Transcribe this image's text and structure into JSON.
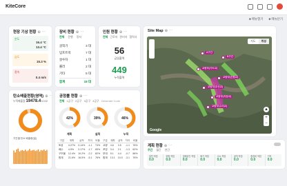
{
  "app": {
    "brand": "KiteCore"
  },
  "subbar": {
    "item1": "■ 메뉴열기",
    "item2": "■ 메뉴닫기"
  },
  "weather": {
    "title": "현장 기상 현황",
    "t1_label": "온도",
    "t1_max": "16.4 °C",
    "t1_min": "13.4 °C",
    "h_label": "습도",
    "h_val": "15.3 %",
    "w_label": "풍속",
    "w_val": "0.4 m/s"
  },
  "equipment": {
    "title": "장비 현황",
    "tabs": [
      "전체",
      "운행",
      "정지"
    ],
    "rows": [
      {
        "name": "굴착기",
        "value": "3 대"
      },
      {
        "name": "덤프트럭",
        "value": "7 대"
      },
      {
        "name": "살수차",
        "value": "1 대"
      },
      {
        "name": "롤러",
        "value": "2 대"
      },
      {
        "name": "기타",
        "value": "5 대"
      }
    ],
    "total_label": "합계",
    "total_value": "18 대"
  },
  "personnel": {
    "title": "인원 현황",
    "tabs": [
      "전체",
      "근로자",
      "관리자",
      "협력사"
    ],
    "v1": "56",
    "v1_label": "금일출역",
    "v2": "449",
    "v2_label": "누적출역"
  },
  "emission": {
    "title": "탄소배출현황(영역)",
    "big_label": "누적배출량",
    "big_value": "19478.4",
    "big_unit": "tCO2",
    "donut_pct": 0.95,
    "bar_title": "기간별 탄소 배출량(일)",
    "bars": [
      0.7,
      0.6,
      0.75,
      0.8,
      0.65,
      0.7,
      0.72,
      0.68,
      0.74,
      0.66,
      0.7,
      0.78,
      0.69,
      0.71,
      0.73,
      0.67,
      0.7,
      0.76,
      0.64,
      0.72,
      0.7,
      0.75,
      0.68,
      0.73
    ]
  },
  "progress": {
    "title": "공정률 현황",
    "tabs": [
      "전체",
      "1공구",
      "2공구",
      "3공구",
      "4공구"
    ],
    "extra": "Generate Code",
    "donuts": [
      {
        "pct": "42%",
        "frac": 0.42,
        "label": "계획"
      },
      {
        "pct": "39%",
        "frac": 0.39,
        "label": "실적"
      },
      {
        "pct": "46%",
        "frac": 0.46,
        "label": "누적"
      }
    ],
    "table_head": [
      "구분",
      "계획",
      "실적",
      "차이",
      "비율",
      "구분",
      "계획",
      "실적",
      "차이",
      "비율"
    ],
    "table_rows": [
      [
        "토공",
        "4.27%",
        "3.14%",
        "-1.1",
        "74%",
        "교량",
        "4.6",
        "3.5",
        "-1.1",
        "76%"
      ],
      [
        "배수",
        "4.9%",
        "3.17%",
        "-1.7",
        "65%",
        "포장",
        "3.4",
        "2.1",
        "-1.3",
        "62%"
      ],
      [
        "구조물",
        "12.4%",
        "10.2%",
        "-2.2",
        "82%",
        "부대",
        "5.1",
        "4.4",
        "-0.7",
        "86%"
      ],
      [
        "합계",
        "21.6%",
        "16.5%",
        "-5.1",
        "76%",
        "합계",
        "13.1",
        "10.0",
        "-3.1",
        "76%"
      ]
    ]
  },
  "sitemap": {
    "title": "Site Map",
    "tab_map": "지도",
    "tab_sat": "위성",
    "pins": [
      {
        "label": "A구간"
      },
      {
        "label": "B구간"
      },
      {
        "label": "교량부(가도교)"
      },
      {
        "label": "교량부(신평교)"
      },
      {
        "label": "교량부(우산교)"
      },
      {
        "label": "교량부(지장교)"
      },
      {
        "label": "교량부(수리교)"
      }
    ],
    "google": "Google"
  },
  "schedule": {
    "title": "계획 현황",
    "tabs": [
      "주간",
      "월간",
      "연간"
    ],
    "cols": [
      {
        "label": "일반 작업",
        "value": "0.0"
      },
      {
        "label": "위험 작업",
        "value": "0.0"
      },
      {
        "label": "밀폐공간 작업",
        "value": "0.0"
      },
      {
        "label": "화기 작업",
        "value": "0.0"
      },
      {
        "label": "고소 작업",
        "value": "0.0"
      },
      {
        "label": "굴착 작업",
        "value": "0.0"
      },
      {
        "label": "중장비 작업",
        "value": "0.0"
      },
      {
        "label": "기타",
        "value": "0.0"
      }
    ]
  }
}
